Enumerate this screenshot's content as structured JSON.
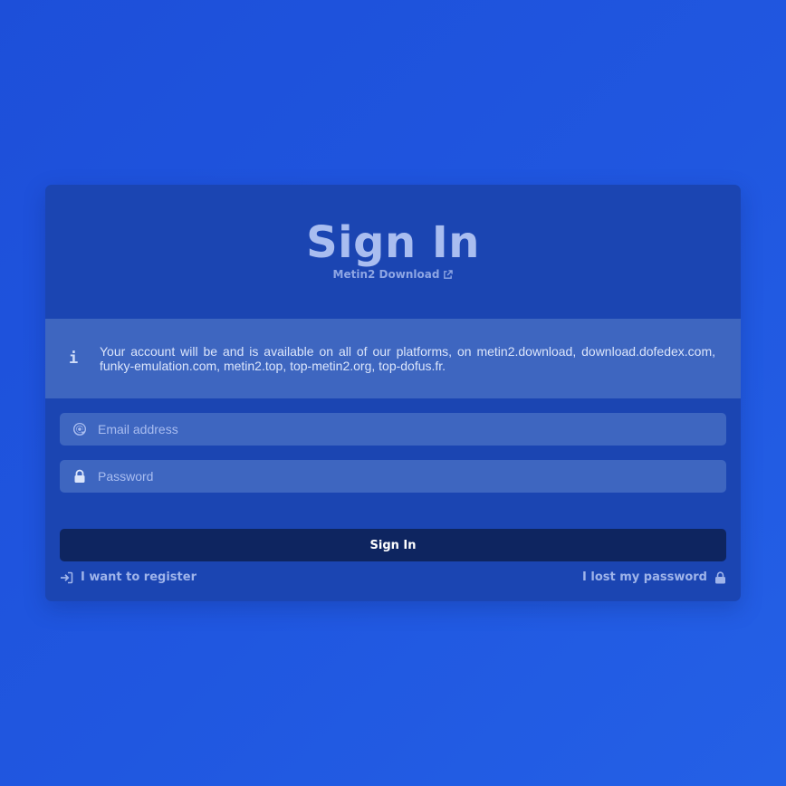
{
  "header": {
    "title": "Sign In",
    "subtitle_link": "Metin2 Download"
  },
  "info": {
    "icon": "info-icon",
    "message": "Your account will be and is available on all of our platforms, on metin2.download, download.dofedex.com, funky-emulation.com, metin2.top, top-metin2.org, top-dofus.fr."
  },
  "form": {
    "email_placeholder": "Email address",
    "password_placeholder": "Password",
    "submit_label": "Sign In"
  },
  "links": {
    "register": "I want to register",
    "lost_password": "I lost my password"
  },
  "colors": {
    "background": "#2057e0",
    "card": "#1b45b2",
    "field": "#3e66c0",
    "button": "#0e2560"
  }
}
